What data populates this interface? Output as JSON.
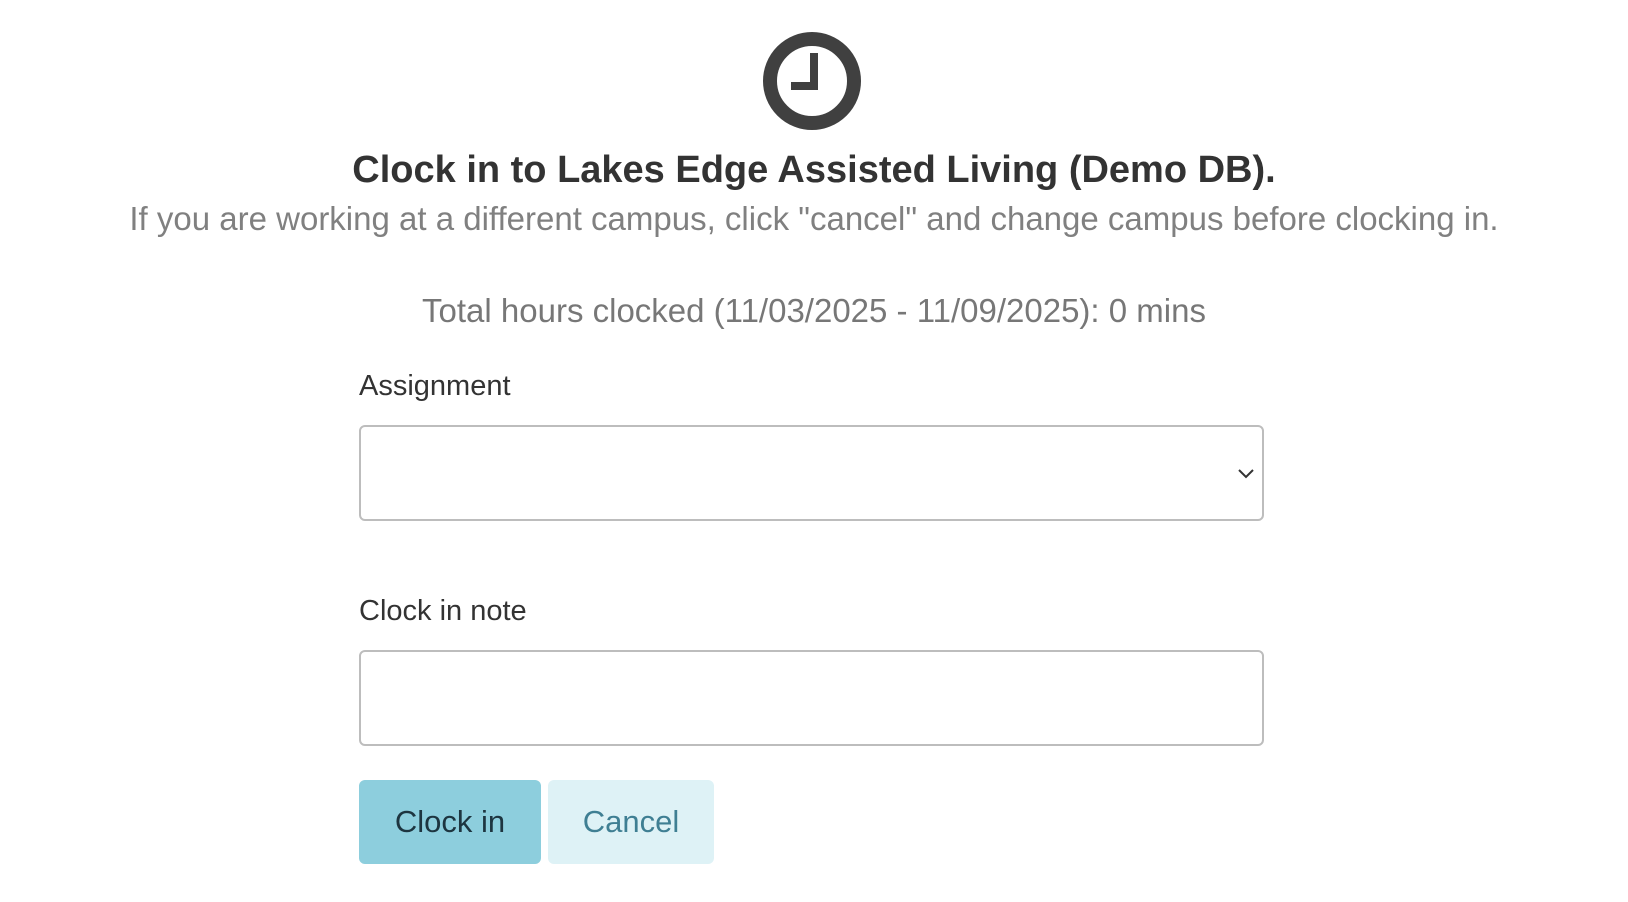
{
  "header": {
    "icon": "clock-icon",
    "title": "Clock in to Lakes Edge Assisted Living (Demo DB).",
    "subtitle": "If you are working at a different campus, click \"cancel\" and change campus before clocking in."
  },
  "summary": {
    "total_hours": "Total hours clocked (11/03/2025 - 11/09/2025): 0 mins"
  },
  "form": {
    "assignment_label": "Assignment",
    "assignment_value": "",
    "note_label": "Clock in note",
    "note_value": ""
  },
  "actions": {
    "clock_in_label": "Clock in",
    "cancel_label": "Cancel"
  },
  "colors": {
    "icon": "#404040",
    "primary_button": "#8dcedd",
    "secondary_button": "#def2f6",
    "secondary_button_text": "#3f7f93"
  }
}
